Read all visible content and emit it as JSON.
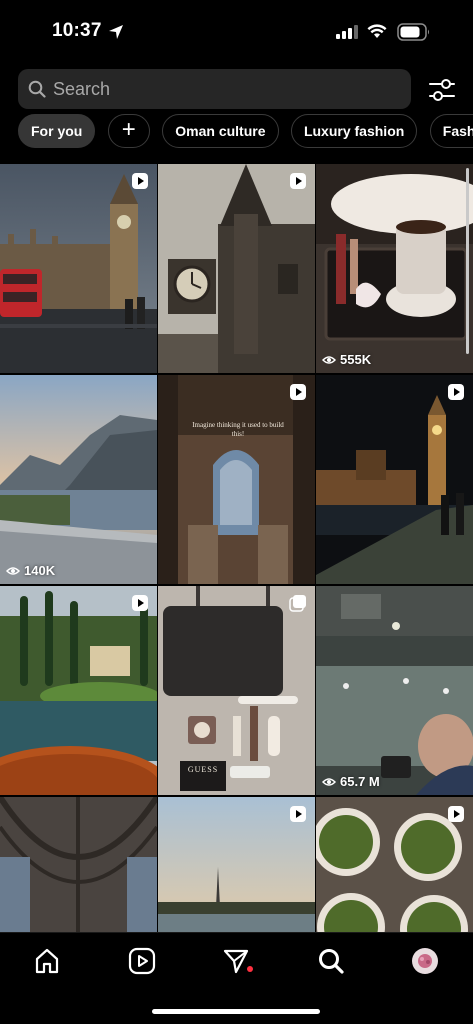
{
  "status_bar": {
    "time": "10:37"
  },
  "search": {
    "placeholder": "Search"
  },
  "chips": [
    {
      "label": "For you",
      "active": true
    },
    {
      "label": "+"
    },
    {
      "label": "Oman culture"
    },
    {
      "label": "Luxury fashion"
    },
    {
      "label": "Fashion"
    }
  ],
  "grid": {
    "tiles": [
      {
        "subject": "Big Ben and red bus, London",
        "badge": "reel-icon"
      },
      {
        "subject": "Gothic clock tower",
        "badge": "reel-icon"
      },
      {
        "subject": "Coffee cup on tray",
        "views": "555K"
      },
      {
        "subject": "Mountain lake view",
        "views": "140K"
      },
      {
        "subject": "Ornate cathedral interior",
        "overlay_text": "Imagine thinking it used to build this!",
        "badge": "reel-icon"
      },
      {
        "subject": "Big Ben at night",
        "badge": "reel-icon"
      },
      {
        "subject": "Lake Como villa and boat",
        "badge": "reel-icon"
      },
      {
        "subject": "Handbag flat lay",
        "badge": "carousel-icon",
        "bag_text": "GUESS"
      },
      {
        "subject": "Foggy concert hall",
        "views": "65.7 M"
      },
      {
        "subject": "Vaulted cathedral ceiling"
      },
      {
        "subject": "Eiffel Tower over the Seine",
        "badge": "reel-icon"
      },
      {
        "subject": "Matcha cups",
        "badge": "reel-icon"
      }
    ]
  },
  "nav": {
    "items": [
      "home-icon",
      "reels-icon",
      "messages-icon",
      "search-icon",
      "profile-avatar"
    ]
  },
  "colors": {
    "background": "#000000",
    "surface": "#262626",
    "notification": "#ff3040"
  }
}
